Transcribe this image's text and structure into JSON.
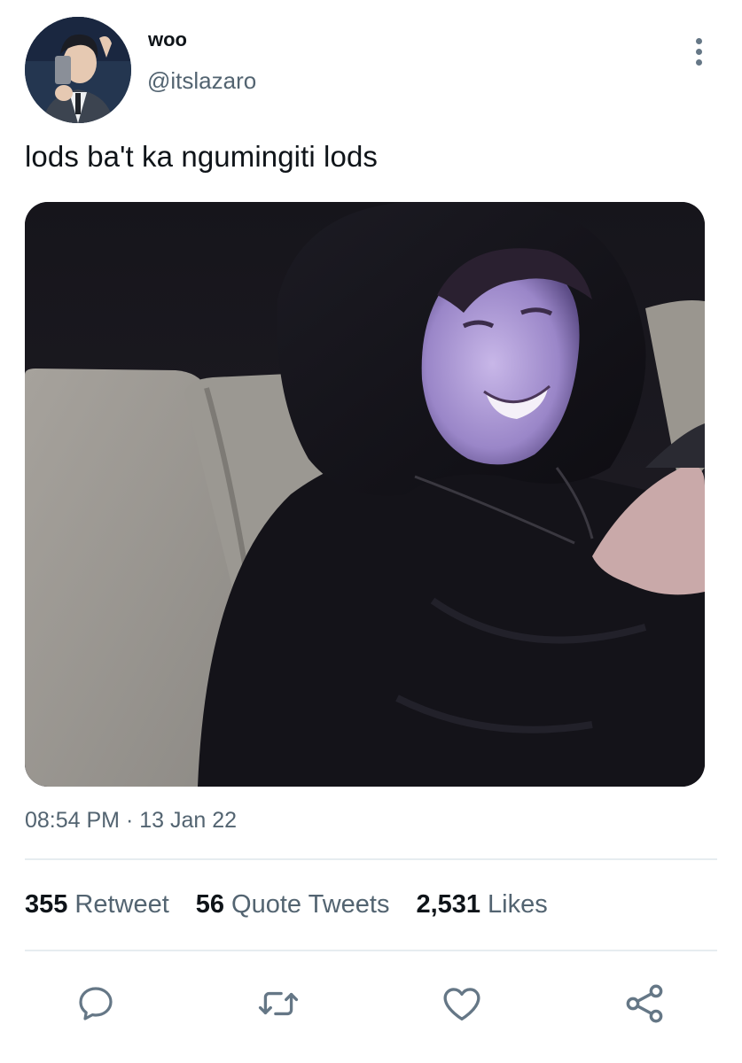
{
  "user": {
    "display_name": "woo",
    "handle": "@itslazaro"
  },
  "tweet": {
    "text": "lods ba't ka ngumingiti lods",
    "time": "08:54 PM",
    "separator": "·",
    "date": "13 Jan 22"
  },
  "stats": {
    "retweets": {
      "count": "355",
      "label": "Retweet"
    },
    "quotes": {
      "count": "56",
      "label": "Quote Tweets"
    },
    "likes": {
      "count": "2,531",
      "label": "Likes"
    }
  },
  "icons": {
    "more": "more-vertical-icon",
    "reply": "reply-icon",
    "retweet": "retweet-icon",
    "like": "heart-icon",
    "share": "share-icon"
  },
  "colors": {
    "text": "#0f1419",
    "secondary": "#536471",
    "divider": "#e6ecf0",
    "icon": "#657786"
  }
}
